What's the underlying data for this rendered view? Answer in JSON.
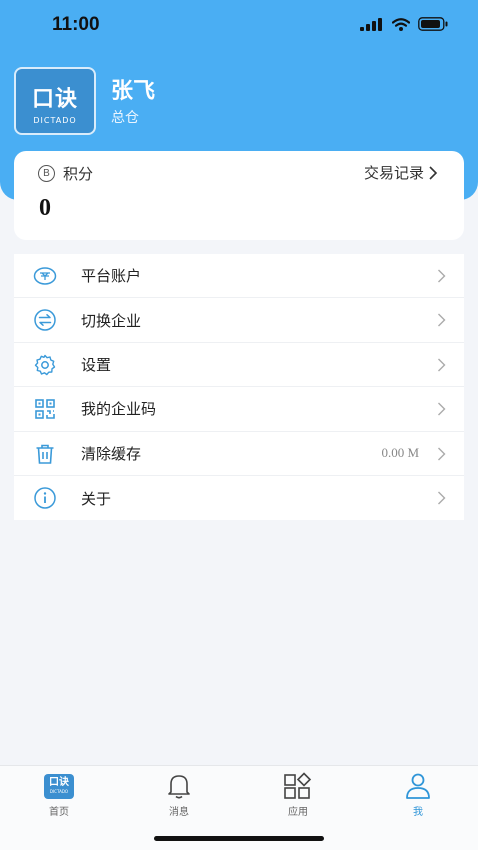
{
  "status_bar": {
    "time": "11:00"
  },
  "profile": {
    "logo_main": "口诀",
    "logo_sub": "DICTADO",
    "name": "张飞",
    "role": "总仓"
  },
  "points": {
    "coin_symbol": "B",
    "label": "积分",
    "transactions_label": "交易记录",
    "value": "0"
  },
  "menu": {
    "items": [
      {
        "label": "平台账户",
        "icon": "account-icon",
        "value": ""
      },
      {
        "label": "切换企业",
        "icon": "switch-icon",
        "value": ""
      },
      {
        "label": "设置",
        "icon": "gear-icon",
        "value": ""
      },
      {
        "label": "我的企业码",
        "icon": "qrcode-icon",
        "value": ""
      },
      {
        "label": "清除缓存",
        "icon": "trash-icon",
        "value": "0.00 M"
      },
      {
        "label": "关于",
        "icon": "info-icon",
        "value": ""
      }
    ]
  },
  "tabbar": {
    "tabs": [
      {
        "label": "首页",
        "icon": "home-logo-icon"
      },
      {
        "label": "消息",
        "icon": "bell-icon"
      },
      {
        "label": "应用",
        "icon": "apps-icon"
      },
      {
        "label": "我",
        "icon": "user-icon"
      }
    ],
    "home_logo_text": "口诀",
    "home_logo_sub": "DICTADO"
  },
  "colors": {
    "accent": "#4aaef3",
    "icon_blue": "#3b9ad9",
    "active_tab": "#2f95d8"
  }
}
